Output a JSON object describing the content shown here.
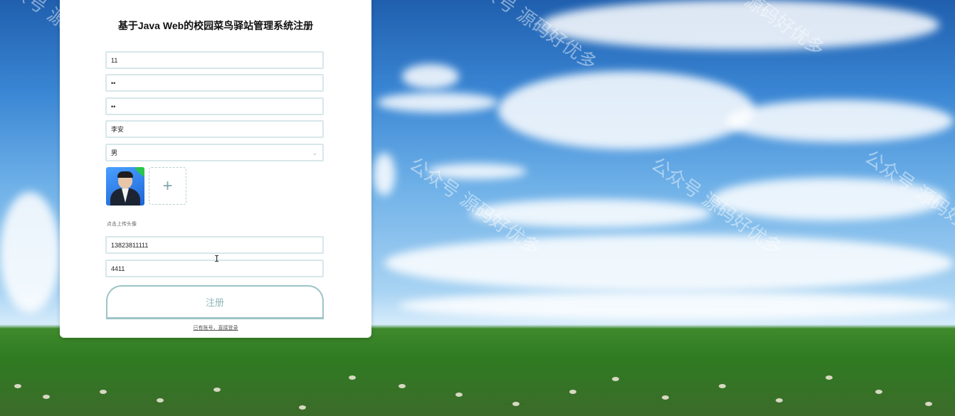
{
  "page": {
    "title": "基于Java Web的校园菜鸟驿站管理系统注册"
  },
  "form": {
    "username_value": "11",
    "password_value": "••",
    "confirm_password_value": "••",
    "name_value": "李安",
    "gender_value": "男",
    "avatar_hint": "点击上传头像",
    "upload_plus": "+",
    "phone_value": "13823811111",
    "code_value": "4411",
    "register_label": "注册",
    "login_link": "已有账号，直接登录"
  },
  "watermark": {
    "text": "公众号 源码好优多"
  },
  "colors": {
    "panel_bg": "#ffffff",
    "field_border": "#d7e7ea",
    "button_border": "#9dc4c8",
    "button_text": "#8fb7bb"
  },
  "icons": {
    "select": "chevron-down-icon",
    "upload": "plus-icon",
    "cursor": "text-cursor-icon"
  }
}
